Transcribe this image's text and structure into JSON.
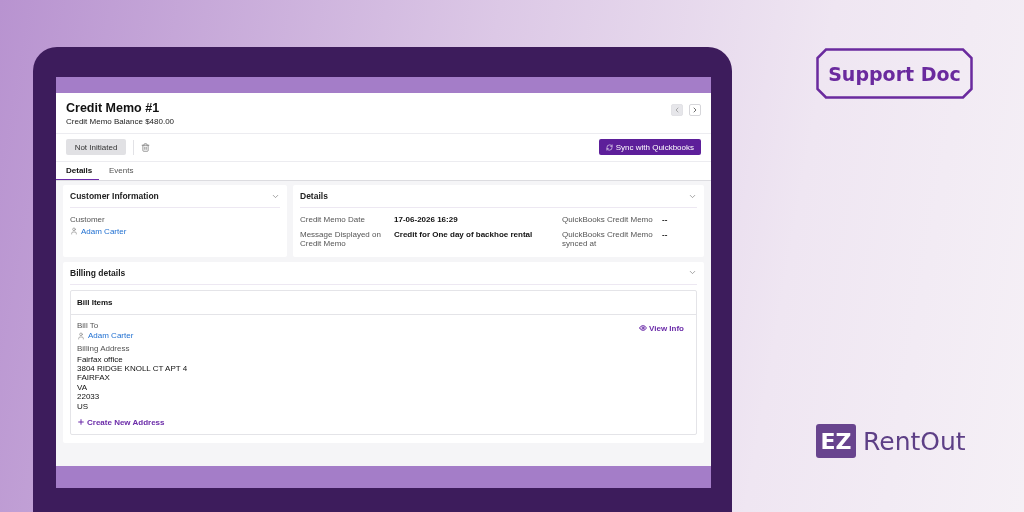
{
  "header": {
    "title": "Credit Memo #1",
    "balance": "Credit Memo Balance $480.00",
    "nav_buttons": [
      {
        "kind": "previous",
        "disabled": true
      },
      {
        "kind": "next",
        "disabled": false
      }
    ]
  },
  "toolbar": {
    "status_button": "Not Initiated",
    "sync_button": "Sync with Quickbooks"
  },
  "tabs": [
    {
      "label": "Details",
      "selected": true
    },
    {
      "label": "Events",
      "selected": false
    }
  ],
  "customer_information": {
    "title": "Customer Information",
    "label": "Customer",
    "customer": "Adam Carter"
  },
  "details": {
    "title": "Details",
    "fields": [
      {
        "label": "Credit Memo Date",
        "value": "17-06-2026 16:29"
      },
      {
        "label": "QuickBooks Credit Memo",
        "value": "--"
      },
      {
        "label": "Message Displayed on Credit Memo",
        "value": "Credit for One day of backhoe rental"
      },
      {
        "label": "QuickBooks Credit Memo synced at",
        "value": "--"
      }
    ]
  },
  "billing_details": {
    "title": "Billing details",
    "bill_items": {
      "title": "Bill Items",
      "bill_to_label": "Bill To",
      "bill_to": "Adam Carter",
      "view_info": "View Info",
      "address_label": "Billing Address",
      "address_lines": [
        "Fairfax office",
        "3804 RIDGE KNOLL CT APT 4",
        "FAIRFAX",
        "VA",
        "22033",
        "US"
      ],
      "create_address": "Create New Address"
    }
  },
  "branding": {
    "badge": "Support Doc",
    "logo_mark": "EZ",
    "logo_text": "RentOut"
  }
}
